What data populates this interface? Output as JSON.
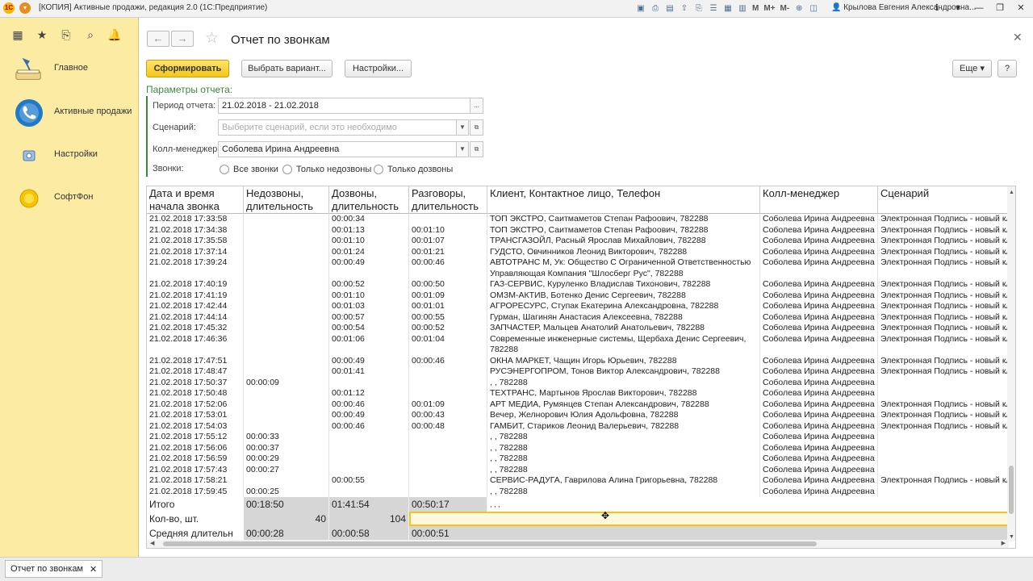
{
  "titlebar": {
    "title": "[КОПИЯ] Активные продажи, редакция 2.0  (1С:Предприятие)",
    "user": "Крылова Евгения Александровна...",
    "m1": "M",
    "m2": "M+",
    "m3": "M-"
  },
  "sidebar": {
    "items": [
      {
        "label": "Главное",
        "icon": "desk-lamp-icon"
      },
      {
        "label": "Активные продажи",
        "icon": "phone-circle-icon"
      },
      {
        "label": "Настройки",
        "icon": "settings-icon"
      },
      {
        "label": "СофтФон",
        "icon": "softphone-icon"
      }
    ]
  },
  "page": {
    "title": "Отчет по звонкам",
    "buttons": {
      "generate": "Сформировать",
      "choose_variant": "Выбрать вариант...",
      "settings": "Настройки...",
      "more": "Еще",
      "help": "?"
    },
    "params_title": "Параметры отчета:",
    "params": {
      "period_label": "Период отчета:",
      "period_value": "21.02.2018 - 21.02.2018",
      "scenario_label": "Сценарий:",
      "scenario_placeholder": "Выберите сценарий, если это необходимо",
      "manager_label": "Колл-менеджер:",
      "manager_value": "Соболева Ирина Андреевна",
      "calls_label": "Звонки:",
      "radio_all": "Все звонки",
      "radio_missed": "Только недозвоны",
      "radio_reached": "Только дозвоны"
    }
  },
  "table": {
    "headers": {
      "date": "Дата и время начала звонка",
      "missed": "Недозвоны, длительность",
      "reached": "Дозвоны, длительность",
      "talk": "Разговоры, длительность",
      "client": "Клиент, Контактное лицо, Телефон",
      "manager": "Колл-менеджер",
      "scenario": "Сценарий"
    },
    "rows": [
      [
        "21.02.2018 17:33:58",
        "",
        "00:00:34",
        "",
        "ТОП ЭКСТРО, Саитмаметов Степан Рафоович, 782288",
        "Соболева Ирина Андреевна",
        "Электронная Подпись - новый кл"
      ],
      [
        "21.02.2018 17:34:38",
        "",
        "00:01:13",
        "00:01:10",
        "ТОП ЭКСТРО, Саитмаметов Степан Рафоович, 782288",
        "Соболева Ирина Андреевна",
        "Электронная Подпись - новый кл"
      ],
      [
        "21.02.2018 17:35:58",
        "",
        "00:01:10",
        "00:01:07",
        "ТРАНСГАЗОЙЛ, Расный Ярослав Михайлович, 782288",
        "Соболева Ирина Андреевна",
        "Электронная Подпись - новый кл"
      ],
      [
        "21.02.2018 17:37:14",
        "",
        "00:01:24",
        "00:01:21",
        "ГУДСТО, Овчинников Леонид Викторович, 782288",
        "Соболева Ирина Андреевна",
        "Электронная Подпись - новый кл"
      ],
      [
        "21.02.2018 17:39:24",
        "",
        "00:00:49",
        "00:00:46",
        "АВТОТРАНС М, Ук: Общество С Ограниченной Ответственностью Управляющая Компания \"Шлосберг Рус\", 782288",
        "Соболева Ирина Андреевна",
        "Электронная Подпись - новый кл"
      ],
      [
        "21.02.2018 17:40:19",
        "",
        "00:00:52",
        "00:00:50",
        "ГАЗ-СЕРВИС, Куруленко Владислав Тихонович, 782288",
        "Соболева Ирина Андреевна",
        "Электронная Подпись - новый кл"
      ],
      [
        "21.02.2018 17:41:19",
        "",
        "00:01:10",
        "00:01:09",
        "ОМЗМ-АКТИВ, Ботенко Денис Сергеевич, 782288",
        "Соболева Ирина Андреевна",
        "Электронная Подпись - новый кл"
      ],
      [
        "21.02.2018 17:42:44",
        "",
        "00:01:03",
        "00:01:01",
        "АГРОРЕСУРС, Ступак Екатерина Александровна, 782288",
        "Соболева Ирина Андреевна",
        "Электронная Подпись - новый кл"
      ],
      [
        "21.02.2018 17:44:14",
        "",
        "00:00:57",
        "00:00:55",
        "Гурман, Шагинян Анастасия Алексеевна, 782288",
        "Соболева Ирина Андреевна",
        "Электронная Подпись - новый кл"
      ],
      [
        "21.02.2018 17:45:32",
        "",
        "00:00:54",
        "00:00:52",
        "ЗАПЧАСТЕР, Мальцев Анатолий Анатольевич, 782288",
        "Соболева Ирина Андреевна",
        "Электронная Подпись - новый кл"
      ],
      [
        "21.02.2018 17:46:36",
        "",
        "00:01:06",
        "00:01:04",
        "Современные инженерные системы, Щербаха Денис Сергеевич, 782288",
        "Соболева Ирина Андреевна",
        "Электронная Подпись - новый кл"
      ],
      [
        "21.02.2018 17:47:51",
        "",
        "00:00:49",
        "00:00:46",
        "ОКНА МАРКЕТ, Чащин Игорь Юрьевич, 782288",
        "Соболева Ирина Андреевна",
        "Электронная Подпись - новый кл"
      ],
      [
        "21.02.2018 17:48:47",
        "",
        "00:01:41",
        "",
        "РУСЭНЕРГОПРОМ, Тонов Виктор Александрович, 782288",
        "Соболева Ирина Андреевна",
        "Электронная Подпись - новый кл"
      ],
      [
        "21.02.2018 17:50:37",
        "00:00:09",
        "",
        "",
        ", , 782288",
        "Соболева Ирина Андреевна",
        ""
      ],
      [
        "21.02.2018 17:50:48",
        "",
        "00:01:12",
        "",
        "ТЕХТРАНС, Мартынов Ярослав Викторович, 782288",
        "Соболева Ирина Андреевна",
        ""
      ],
      [
        "21.02.2018 17:52:06",
        "",
        "00:00:46",
        "00:01:09",
        "АРТ МЕДИА, Румянцев Степан Александрович, 782288",
        "Соболева Ирина Андреевна",
        "Электронная Подпись - новый кл"
      ],
      [
        "21.02.2018 17:53:01",
        "",
        "00:00:49",
        "00:00:43",
        "Вечер, Желнорович Юлия Адольфовна, 782288",
        "Соболева Ирина Андреевна",
        "Электронная Подпись - новый кл"
      ],
      [
        "21.02.2018 17:54:03",
        "",
        "00:00:46",
        "00:00:48",
        "ГАМБИТ, Стариков Леонид Валерьевич, 782288",
        "Соболева Ирина Андреевна",
        "Электронная Подпись - новый кл"
      ],
      [
        "21.02.2018 17:55:12",
        "00:00:33",
        "",
        "",
        ", , 782288",
        "Соболева Ирина Андреевна",
        ""
      ],
      [
        "21.02.2018 17:56:06",
        "00:00:37",
        "",
        "",
        ", , 782288",
        "Соболева Ирина Андреевна",
        ""
      ],
      [
        "21.02.2018 17:56:59",
        "00:00:29",
        "",
        "",
        ", , 782288",
        "Соболева Ирина Андреевна",
        ""
      ],
      [
        "21.02.2018 17:57:43",
        "00:00:27",
        "",
        "",
        ", , 782288",
        "Соболева Ирина Андреевна",
        ""
      ],
      [
        "21.02.2018 17:58:21",
        "",
        "00:00:55",
        "",
        "СЕРВИС-РАДУГА, Гаврилова Алина Григорьевна, 782288",
        "Соболева Ирина Андреевна",
        "Электронная Подпись - новый кл"
      ],
      [
        "21.02.2018 17:59:45",
        "00:00:25",
        "",
        "",
        ", , 782288",
        "Соболева Ирина Андреевна",
        ""
      ]
    ],
    "totals": {
      "total_label": "Итого",
      "total_missed": "00:18:50",
      "total_reached": "01:41:54",
      "total_talk": "00:50:17",
      "total_client": ", , ,",
      "count_label": "Кол-во, шт.",
      "count_missed": "40",
      "count_reached": "104",
      "avg_label": "Средняя длительн",
      "avg_missed": "00:00:28",
      "avg_reached": "00:00:58",
      "avg_talk": "00:00:51"
    }
  },
  "bottom_tab": {
    "label": "Отчет по звонкам"
  }
}
